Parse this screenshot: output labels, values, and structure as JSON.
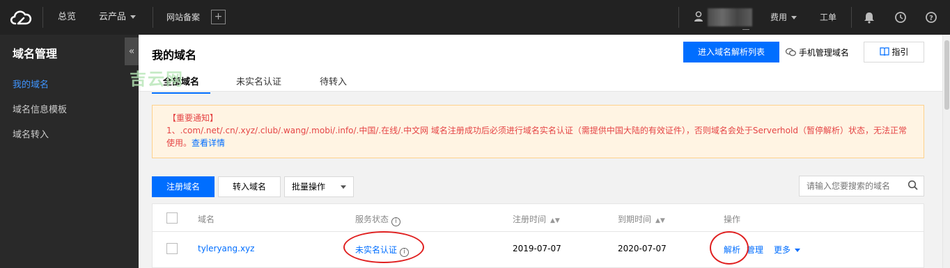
{
  "topbar": {
    "overview": "总览",
    "products": "云产品",
    "icp": "网站备案",
    "plus": "+",
    "billing": "费用",
    "ticket": "工单",
    "icons": [
      "cloud-logo-icon",
      "user-icon",
      "bell-icon",
      "clock-icon",
      "help-icon"
    ]
  },
  "sidebar": {
    "title": "域名管理",
    "collapse": "«",
    "items": [
      {
        "label": "我的域名",
        "active": true
      },
      {
        "label": "域名信息模板",
        "active": false
      },
      {
        "label": "域名转入",
        "active": false
      }
    ]
  },
  "header": {
    "title": "我的域名",
    "tabs": [
      {
        "label": "全部域名",
        "active": true
      },
      {
        "label": "未实名认证",
        "active": false
      },
      {
        "label": "待转入",
        "active": false
      }
    ],
    "dns_list_button": "进入域名解析列表",
    "mobile_manage": "手机管理域名",
    "guide_button": "指引"
  },
  "watermark": "吉云网",
  "notice": {
    "title": "【重要通知】",
    "body": "1、.com/.net/.cn/.xyz/.club/.wang/.mobi/.info/.中国/.在线/.中文网 域名注册成功后必须进行域名实名认证（需提供中国大陆的有效证件），否则域名会处于Serverhold（暂停解析）状态，无法正常使用。",
    "link": "查看详情"
  },
  "toolbar": {
    "register": "注册域名",
    "transfer": "转入域名",
    "batch": "批量操作",
    "search_placeholder": "请输入您要搜索的域名"
  },
  "table": {
    "columns": [
      "域名",
      "服务状态",
      "注册时间",
      "到期时间",
      "操作"
    ],
    "rows": [
      {
        "domain": "tyleryang.xyz",
        "status": "未实名认证",
        "registered": "2019-07-07",
        "expires": "2020-07-07",
        "actions": [
          "解析",
          "管理",
          "更多"
        ]
      }
    ]
  },
  "colors": {
    "primary": "#006eff",
    "topbar_bg": "#222222",
    "sidebar_bg": "#292929",
    "notice_bg": "#fff4e3",
    "notice_text": "#e54545",
    "annotation_circle": "#e02020"
  }
}
